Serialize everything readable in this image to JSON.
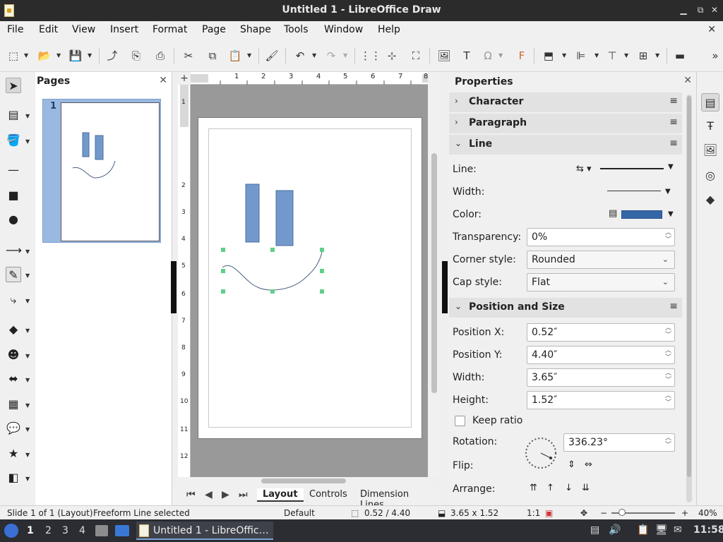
{
  "window": {
    "title": "Untitled 1 - LibreOffice Draw"
  },
  "menu": [
    "File",
    "Edit",
    "View",
    "Insert",
    "Format",
    "Page",
    "Shape",
    "Tools",
    "Window",
    "Help"
  ],
  "pages_panel": {
    "title": "Pages",
    "page_number": "1"
  },
  "rulers": {
    "h_ticks": [
      "1",
      "2",
      "3",
      "4",
      "5",
      "6",
      "7",
      "8"
    ],
    "v_ticks": [
      "1",
      "2",
      "3",
      "4",
      "5",
      "6",
      "7",
      "8",
      "9",
      "10",
      "11",
      "12"
    ]
  },
  "tabs": [
    "Layout",
    "Controls",
    "Dimension Lines"
  ],
  "properties": {
    "title": "Properties",
    "sections": {
      "character": "Character",
      "paragraph": "Paragraph",
      "line": "Line",
      "position_size": "Position and Size"
    },
    "line": {
      "line_label": "Line:",
      "width_label": "Width:",
      "color_label": "Color:",
      "color": "#3566a8",
      "transparency_label": "Transparency:",
      "transparency": "0%",
      "corner_label": "Corner style:",
      "corner_value": "Rounded",
      "cap_label": "Cap style:",
      "cap_value": "Flat"
    },
    "position": {
      "x_label": "Position X:",
      "x": "0.52″",
      "y_label": "Position Y:",
      "y": "4.40″",
      "width_label": "Width:",
      "width": "3.65″",
      "height_label": "Height:",
      "height": "1.52″",
      "keep_ratio": "Keep ratio",
      "rotation_label": "Rotation:",
      "rotation": "336.23°",
      "flip_label": "Flip:",
      "arrange_label": "Arrange:"
    }
  },
  "status": {
    "slide": "Slide 1 of 1 (Layout)",
    "selection": "Freeform Line selected",
    "layout": "Default",
    "position": "0.52 / 4.40",
    "size": "3.65 x 1.52",
    "scale": "1:1",
    "zoom": "40%"
  },
  "taskbar": {
    "workspaces": [
      "1",
      "2",
      "3",
      "4"
    ],
    "app_label": "Untitled 1 - LibreOffic…",
    "clock": "11:58"
  },
  "shapes": {
    "fill": "#7399cc",
    "stroke": "#4a6f9f",
    "handle": "#5fcf8a"
  }
}
